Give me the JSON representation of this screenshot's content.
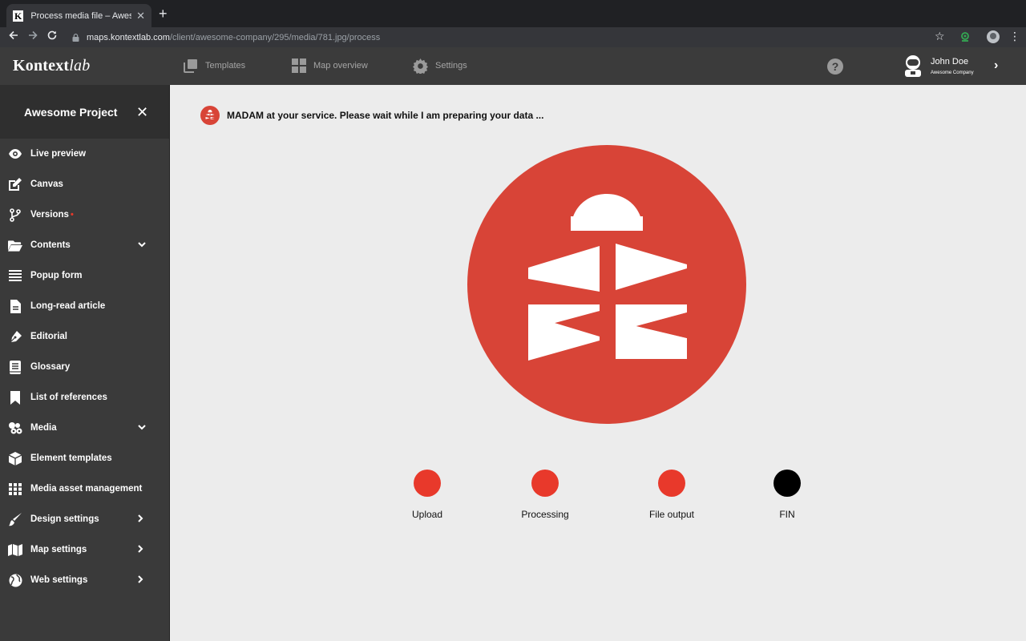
{
  "browser": {
    "tab_title": "Process media file – Awesome",
    "tab_favicon": "K",
    "tab_close": "✕",
    "new_tab": "+",
    "url_host": "maps.kontextlab.com",
    "url_path": "/client/awesome-company/295/media/781.jpg/process"
  },
  "header": {
    "logo_main": "Kontext",
    "logo_italic": "lab",
    "nav": [
      {
        "label": "Templates",
        "icon": "copy-icon"
      },
      {
        "label": "Map overview",
        "icon": "grid-icon"
      },
      {
        "label": "Settings",
        "icon": "gear-icon"
      }
    ],
    "help": "?",
    "user_name": "John Doe",
    "user_company": "Awesome Company"
  },
  "sidebar": {
    "project_title": "Awesome Project",
    "close": "✕",
    "items": [
      {
        "label": "Live preview",
        "icon": "eye-icon"
      },
      {
        "label": "Canvas",
        "icon": "edit-icon"
      },
      {
        "label": "Versions",
        "icon": "branch-icon",
        "dot": "•"
      },
      {
        "label": "Contents",
        "icon": "folder-icon",
        "arrow": "⌄"
      },
      {
        "label": "Popup form",
        "icon": "list-icon"
      },
      {
        "label": "Long-read article",
        "icon": "file-icon"
      },
      {
        "label": "Editorial",
        "icon": "pen-icon"
      },
      {
        "label": "Glossary",
        "icon": "book-icon"
      },
      {
        "label": "List of references",
        "icon": "bookmark-icon"
      },
      {
        "label": "Media",
        "icon": "photo-icon",
        "arrow": "⌄"
      },
      {
        "label": "Element templates",
        "icon": "cube-icon"
      },
      {
        "label": "Media asset management",
        "icon": "grid-dots-icon"
      },
      {
        "label": "Design settings",
        "icon": "brush-icon",
        "arrow": "›"
      },
      {
        "label": "Map settings",
        "icon": "map-icon",
        "arrow": "›"
      },
      {
        "label": "Web settings",
        "icon": "globe-icon",
        "arrow": "›"
      }
    ]
  },
  "main": {
    "status_text": "MADAM at your service. Please wait while I am preparing your data ...",
    "steps": [
      {
        "label": "Upload",
        "color": "#e8392b"
      },
      {
        "label": "Processing",
        "color": "#e8392b"
      },
      {
        "label": "File output",
        "color": "#e8392b"
      },
      {
        "label": "FIN",
        "color": "#000000"
      }
    ]
  },
  "colors": {
    "brand_red": "#d84437",
    "step_red": "#e8392b",
    "sidebar_bg": "#3a3a3a",
    "header_bg": "#3b3b3b"
  }
}
